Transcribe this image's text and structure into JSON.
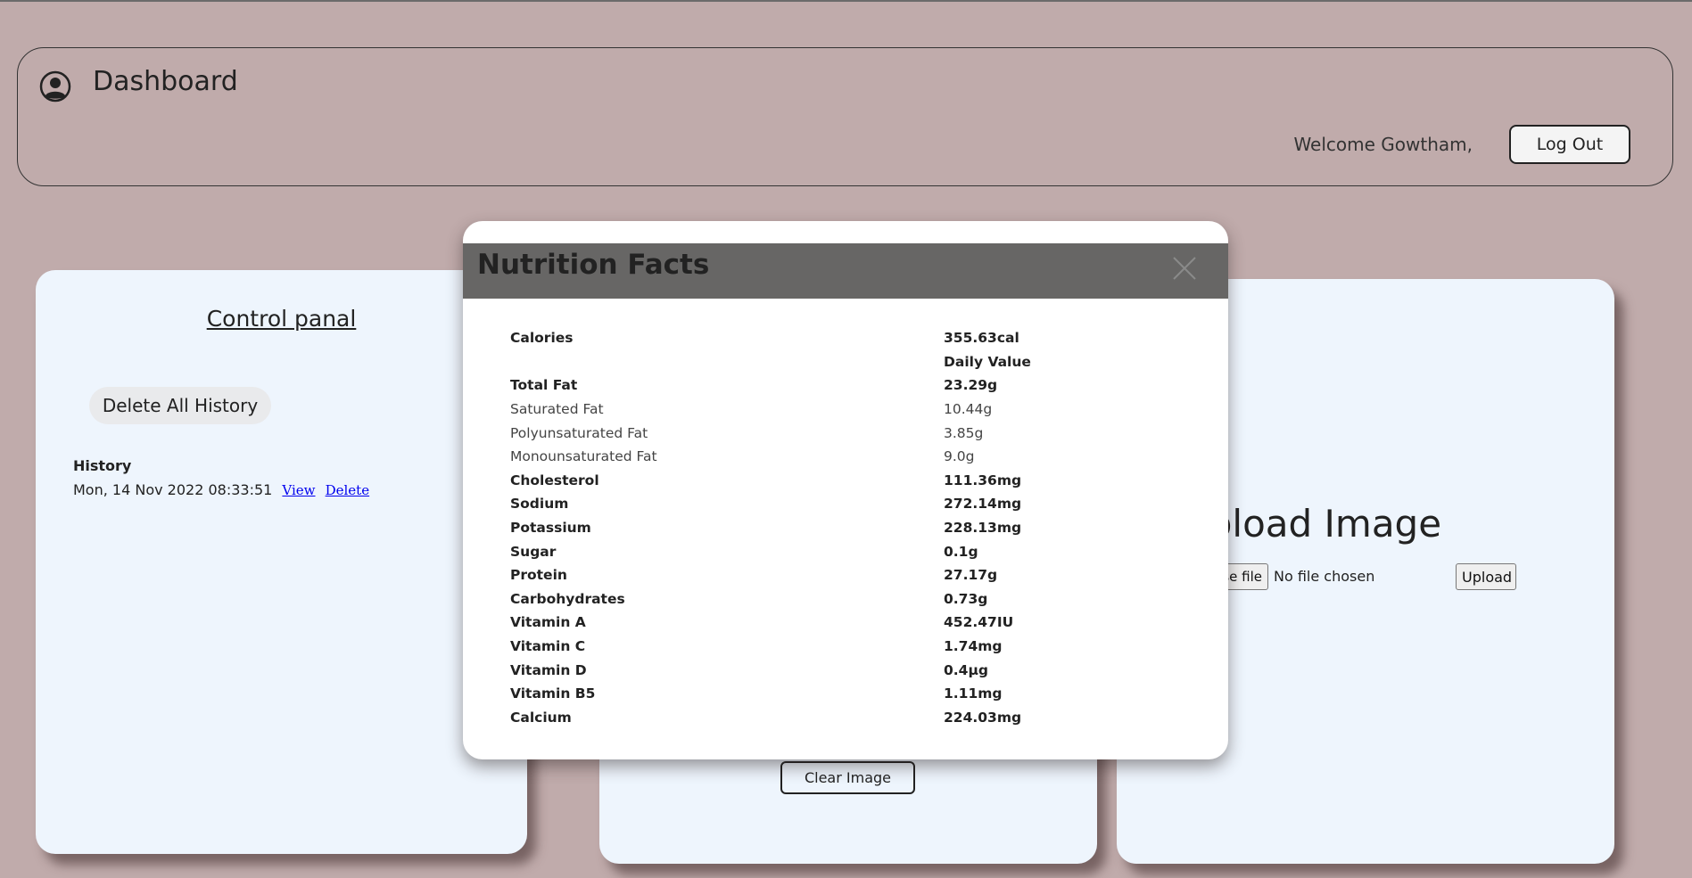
{
  "header": {
    "title": "Dashboard",
    "welcome": "Welcome Gowtham,",
    "logout_label": "Log Out"
  },
  "control_panel": {
    "title": "Control panal",
    "delete_all_label": "Delete All History",
    "history_label": "History",
    "history": [
      {
        "timestamp": "Mon, 14 Nov 2022 08:33:51",
        "view_label": "View",
        "delete_label": "Delete"
      }
    ]
  },
  "middle_card": {
    "clear_label": "Clear Image"
  },
  "upload_card": {
    "title": "Upload Image",
    "choose_label": "Choose file",
    "no_file": "No file chosen",
    "upload_label": "Upload"
  },
  "modal": {
    "title": "Nutrition Facts",
    "rows": [
      {
        "label": "Calories",
        "value": "355.63cal",
        "bold": true
      },
      {
        "label": "",
        "value": "Daily Value",
        "bold": true
      },
      {
        "label": "Total Fat",
        "value": "23.29g",
        "bold": true
      },
      {
        "label": "Saturated Fat",
        "value": "10.44g",
        "bold": false
      },
      {
        "label": "Polyunsaturated Fat",
        "value": "3.85g",
        "bold": false
      },
      {
        "label": "Monounsaturated Fat",
        "value": "9.0g",
        "bold": false
      },
      {
        "label": "Cholesterol",
        "value": "111.36mg",
        "bold": true
      },
      {
        "label": "Sodium",
        "value": "272.14mg",
        "bold": true
      },
      {
        "label": "Potassium",
        "value": "228.13mg",
        "bold": true
      },
      {
        "label": "Sugar",
        "value": "0.1g",
        "bold": true
      },
      {
        "label": "Protein",
        "value": "27.17g",
        "bold": true
      },
      {
        "label": "Carbohydrates",
        "value": "0.73g",
        "bold": true
      },
      {
        "label": "Vitamin A",
        "value": "452.47IU",
        "bold": true
      },
      {
        "label": "Vitamin C",
        "value": "1.74mg",
        "bold": true
      },
      {
        "label": "Vitamin D",
        "value": "0.4µg",
        "bold": true
      },
      {
        "label": "Vitamin B5",
        "value": "1.11mg",
        "bold": true
      },
      {
        "label": "Calcium",
        "value": "224.03mg",
        "bold": true
      }
    ]
  },
  "colors": {
    "page_bg": "#c0abab",
    "card_bg": "#eef5fd",
    "modal_header_bg": "#676665"
  }
}
